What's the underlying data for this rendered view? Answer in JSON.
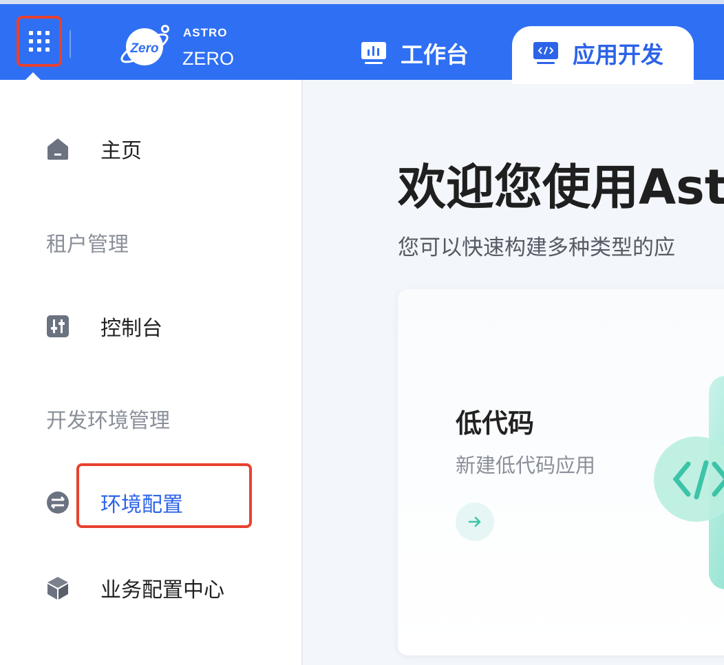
{
  "header": {
    "brand_top": "ASTRO",
    "brand_bottom": "ZERO",
    "logo_text": "Zero",
    "nav": [
      {
        "label": "工作台",
        "icon": "dashboard-icon",
        "active": false
      },
      {
        "label": "应用开发",
        "icon": "code-icon",
        "active": true
      }
    ]
  },
  "sidebar": {
    "items": [
      {
        "type": "item",
        "label": "主页",
        "icon": "home-icon"
      },
      {
        "type": "group",
        "label": "租户管理"
      },
      {
        "type": "item",
        "label": "控制台",
        "icon": "console-icon"
      },
      {
        "type": "group",
        "label": "开发环境管理"
      },
      {
        "type": "item",
        "label": "环境配置",
        "icon": "env-config-icon",
        "active": true
      },
      {
        "type": "item",
        "label": "业务配置中心",
        "icon": "cube-icon"
      }
    ]
  },
  "main": {
    "title": "欢迎您使用Ast",
    "subtitle": "您可以快速构建多种类型的应",
    "card": {
      "title": "低代码",
      "subtitle": "新建低代码应用",
      "illustration": "code-brackets-icon",
      "arrow": "arrow-right-icon"
    }
  },
  "colors": {
    "brand": "#2f6ff3",
    "active_text": "#2c63e8",
    "highlight": "#e8412f",
    "teal": "#3cc4a8"
  }
}
